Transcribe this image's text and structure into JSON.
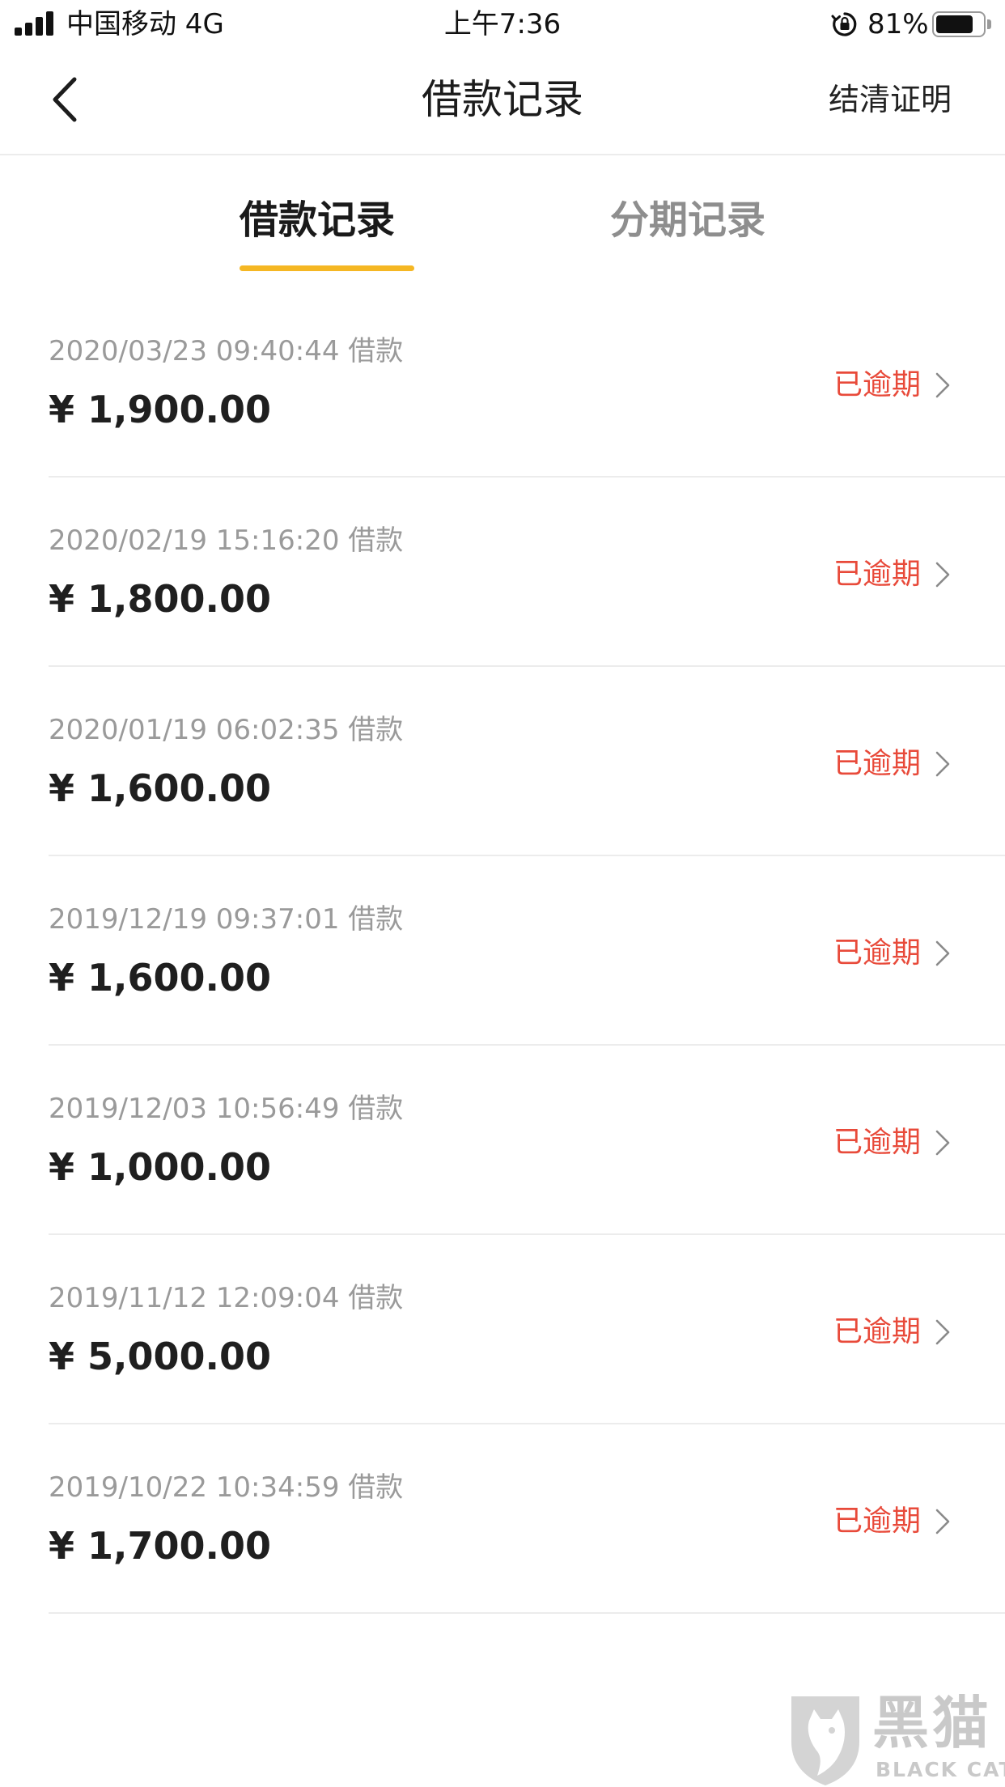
{
  "status_bar": {
    "carrier": "中国移动 4G",
    "time": "上午7:36",
    "battery_percent": "81%",
    "battery_level": 0.81
  },
  "nav": {
    "title": "借款记录",
    "action_label": "结清证明"
  },
  "tabs": [
    {
      "label": "借款记录",
      "active": true
    },
    {
      "label": "分期记录",
      "active": false
    }
  ],
  "loans": [
    {
      "date": "2020/03/23 09:40:44 借款",
      "amount": "¥ 1,900.00",
      "status": "已逾期"
    },
    {
      "date": "2020/02/19 15:16:20 借款",
      "amount": "¥ 1,800.00",
      "status": "已逾期"
    },
    {
      "date": "2020/01/19 06:02:35 借款",
      "amount": "¥ 1,600.00",
      "status": "已逾期"
    },
    {
      "date": "2019/12/19 09:37:01 借款",
      "amount": "¥ 1,600.00",
      "status": "已逾期"
    },
    {
      "date": "2019/12/03 10:56:49 借款",
      "amount": "¥ 1,000.00",
      "status": "已逾期"
    },
    {
      "date": "2019/11/12 12:09:04 借款",
      "amount": "¥ 5,000.00",
      "status": "已逾期"
    },
    {
      "date": "2019/10/22 10:34:59 借款",
      "amount": "¥ 1,700.00",
      "status": "已逾期"
    }
  ],
  "watermark": {
    "name_cn": "黑猫",
    "name_en": "BLACK CAT"
  },
  "colors": {
    "accent": "#f5b723",
    "overdue": "#e84a3a",
    "muted_text": "#9a9a9a",
    "divider": "#ececec"
  },
  "icons": {
    "back": "chevron-left-icon",
    "row_arrow": "chevron-right-icon",
    "signal": "signal-bars-icon",
    "rotation_lock": "rotation-lock-icon",
    "battery": "battery-icon",
    "watermark_logo": "cat-shield-logo"
  }
}
